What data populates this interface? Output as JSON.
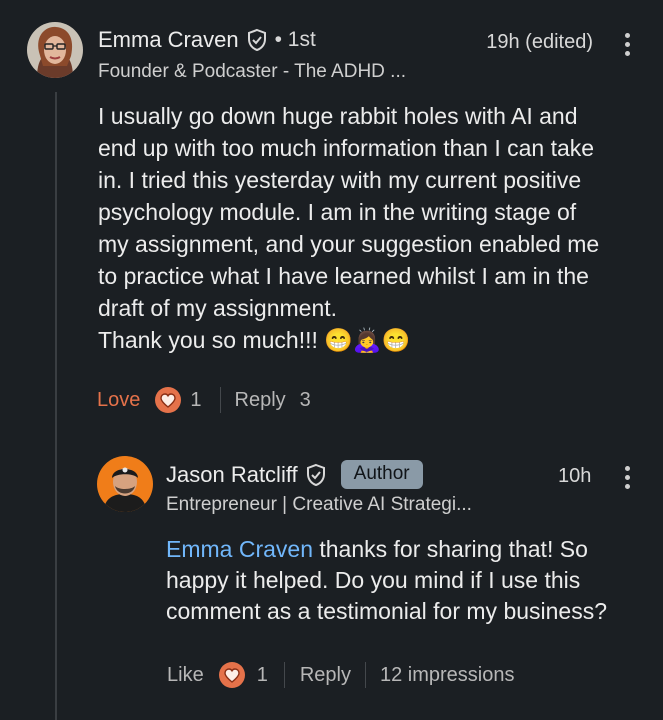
{
  "comment": {
    "author_name": "Emma Craven",
    "connection": "• 1st",
    "headline": "Founder & Podcaster - The ADHD ...",
    "time": "19h (edited)",
    "body_lines": [
      "I usually go down huge rabbit holes with AI and",
      "end up with too much information than I can take",
      "in. I tried this yesterday with my current positive",
      "psychology module. I am in the writing stage of",
      "my assignment, and your suggestion enabled me",
      "to practice what I have learned whilst I am in the",
      "draft of my assignment."
    ],
    "thanks_text": "Thank you so much!!!",
    "emojis": "😁🙇‍♀️😁",
    "react_label": "Love",
    "reaction_count": "1",
    "reply_label": "Reply",
    "reply_count": "3",
    "react_color": "#e5724a"
  },
  "reply": {
    "author_name": "Jason Ratcliff",
    "badge": "Author",
    "headline": "Entrepreneur | Creative AI Strategi...",
    "time": "10h",
    "mention": "Emma Craven",
    "line1_rest": " thanks for sharing that! So",
    "line2": "happy it helped. Do you mind if I use this",
    "line3": "comment as a testimonial for my business?",
    "like_label": "Like",
    "reaction_count": "1",
    "reply_label": "Reply",
    "impressions": "12 impressions",
    "mention_color": "#71b7fb"
  },
  "icons": {
    "verified": "verified-shield-icon",
    "menu": "more-vertical-icon",
    "heart": "heart-reaction-icon"
  }
}
